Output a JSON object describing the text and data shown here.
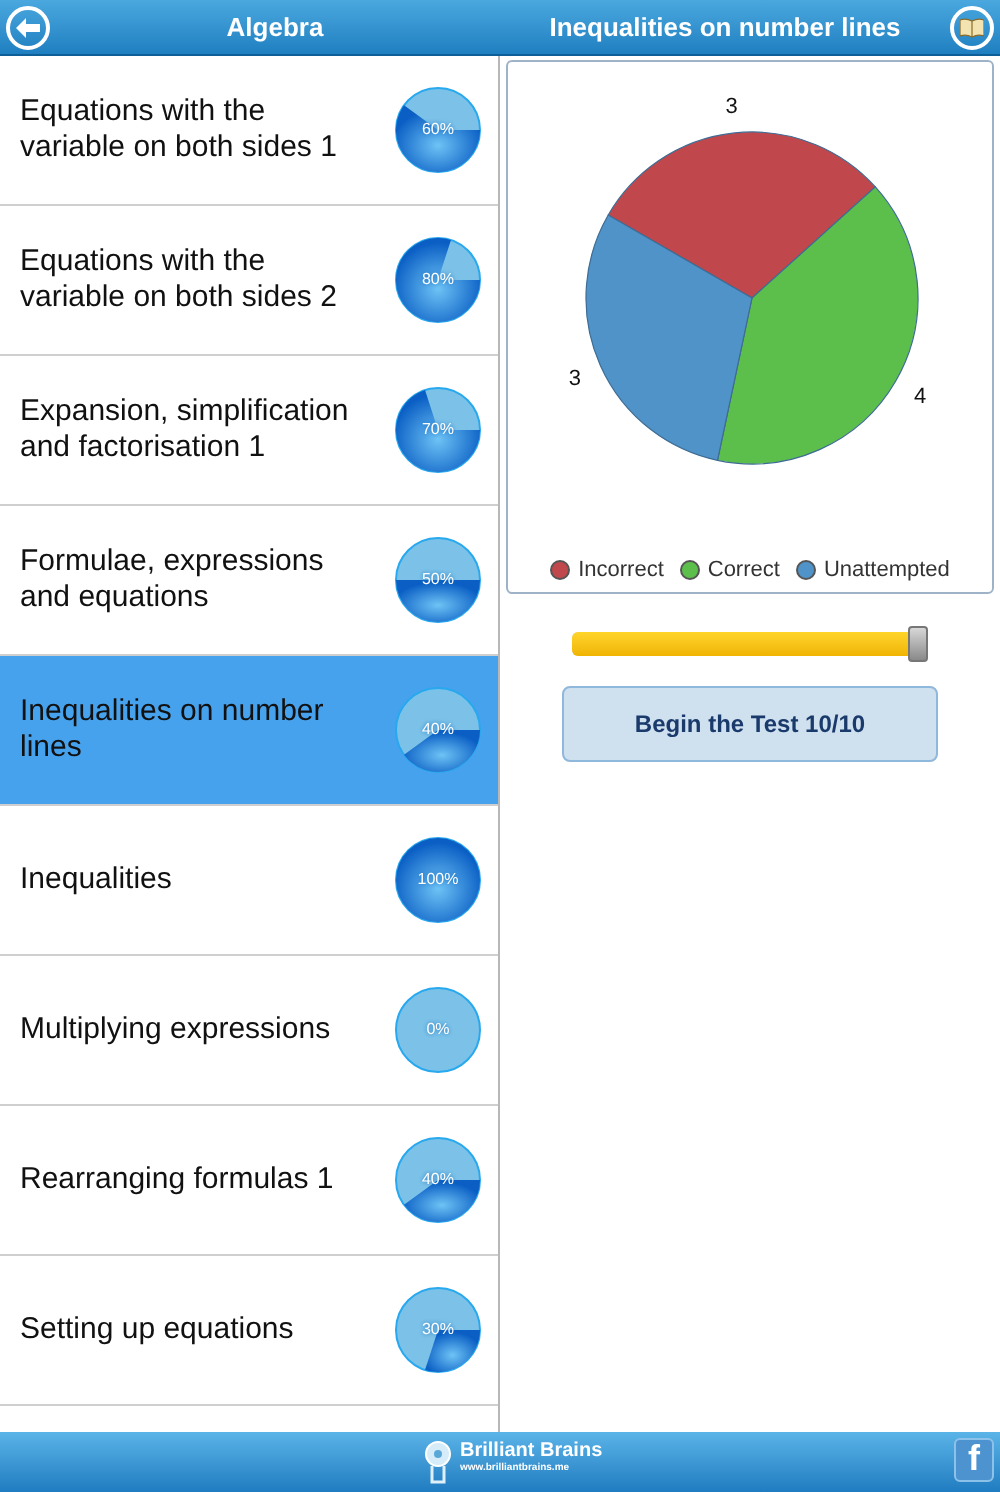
{
  "header": {
    "left_title": "Algebra",
    "right_title": "Inequalities on number lines"
  },
  "topics": [
    {
      "label": "Equations with the variable on both sides 1",
      "percent": "60%",
      "selected": false
    },
    {
      "label": "Equations with the variable on both sides 2",
      "percent": "80%",
      "selected": false
    },
    {
      "label": "Expansion, simplification and factorisation 1",
      "percent": "70%",
      "selected": false
    },
    {
      "label": "Formulae, expressions and equations",
      "percent": "50%",
      "selected": false
    },
    {
      "label": "Inequalities on number lines",
      "percent": "40%",
      "selected": true
    },
    {
      "label": "Inequalities",
      "percent": "100%",
      "selected": false
    },
    {
      "label": "Multiplying expressions",
      "percent": "0%",
      "selected": false
    },
    {
      "label": "Rearranging formulas 1",
      "percent": "40%",
      "selected": false
    },
    {
      "label": "Setting up equations",
      "percent": "30%",
      "selected": false
    }
  ],
  "results": {
    "chart_data": {
      "type": "pie",
      "categories": [
        "Incorrect",
        "Correct",
        "Unattempted"
      ],
      "values": [
        3,
        4,
        3
      ],
      "colors": [
        "#c0474b",
        "#5cbf4c",
        "#4f93c8"
      ],
      "data_labels": true,
      "legend": "bottom"
    }
  },
  "question_slider": {
    "level": 1
  },
  "begin_button": "Begin the Test 10/10",
  "footer": {
    "brand": "Brilliant Brains",
    "url": "www.brilliantbrains.me",
    "facebook_button": "f"
  }
}
